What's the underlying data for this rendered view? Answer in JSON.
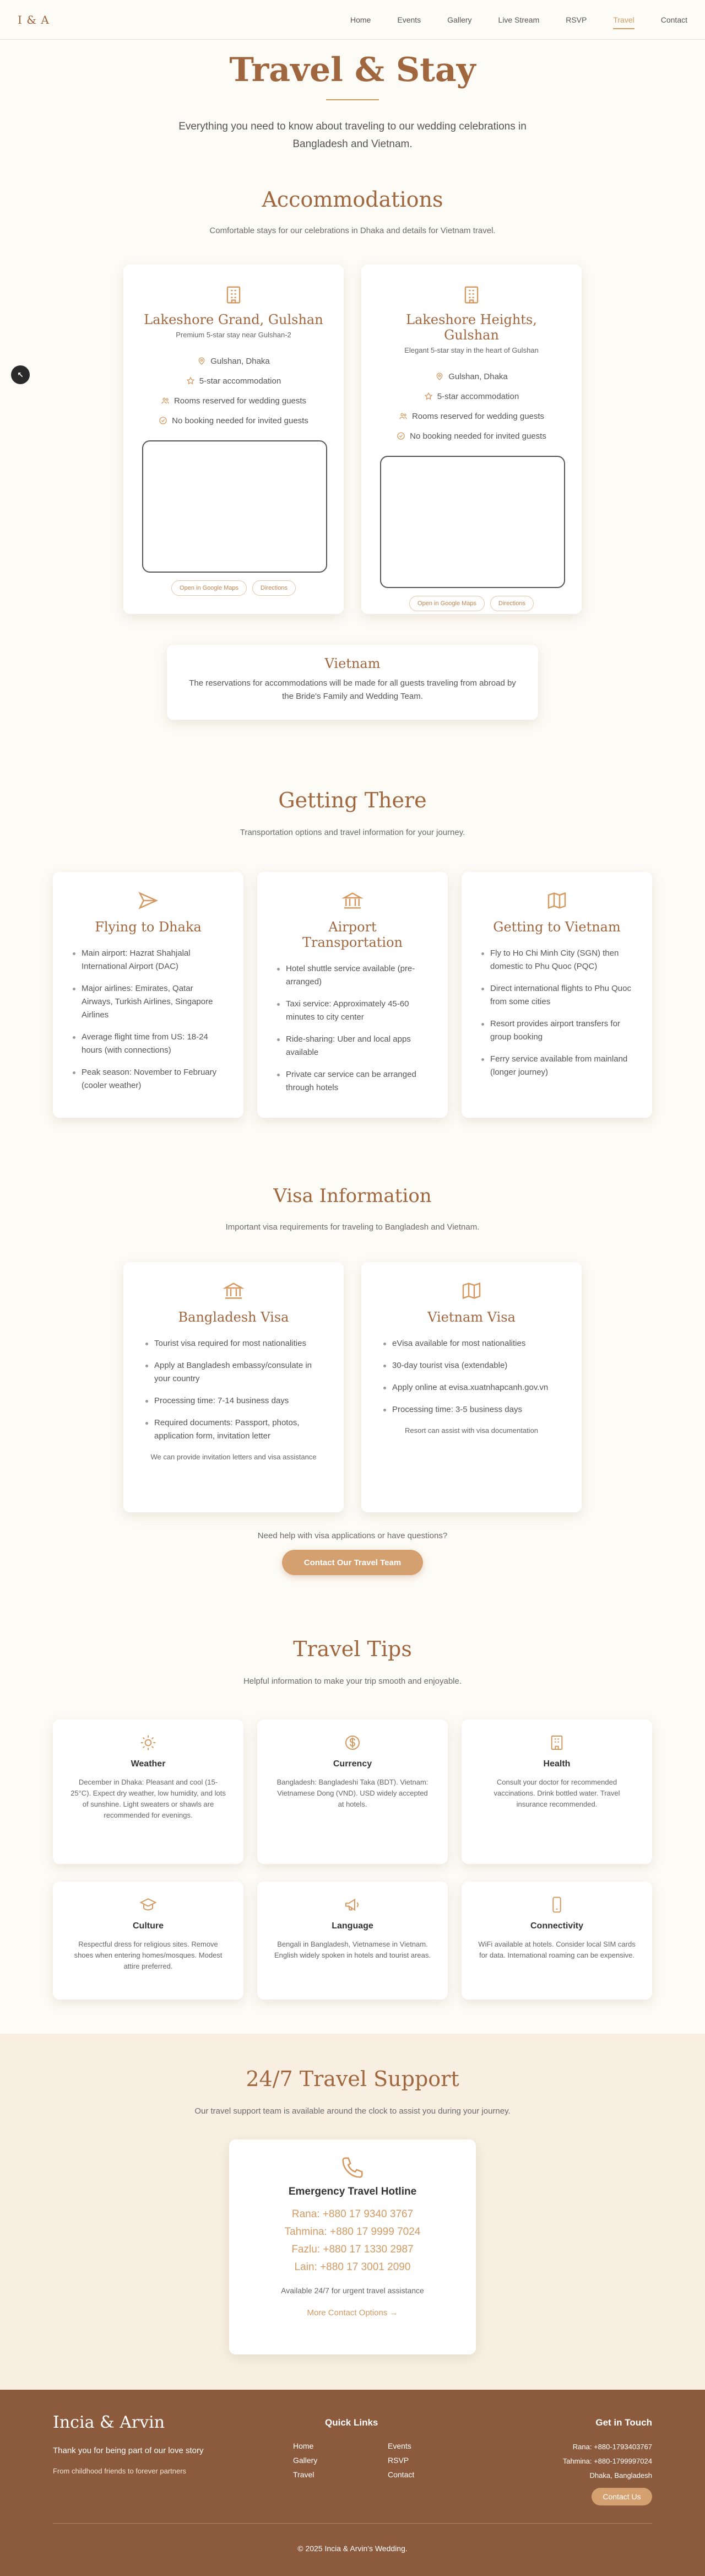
{
  "nav": {
    "logo": "I & A",
    "links": [
      "Home",
      "Events",
      "Gallery",
      "Live Stream",
      "RSVP",
      "Travel",
      "Contact"
    ],
    "active": "Travel"
  },
  "side_button": "↖",
  "hero": {
    "title": "Travel & Stay",
    "text": "Everything you need to know about traveling to our wedding celebrations in Bangladesh and Vietnam."
  },
  "accommodations": {
    "title": "Accommodations",
    "subtitle": "Comfortable stays for our celebrations in Dhaka and details for Vietnam travel.",
    "hotels": [
      {
        "name": "Lakeshore Grand, Gulshan",
        "desc": "Premium 5-star stay near Gulshan-2",
        "location": "Gulshan, Dhaka",
        "rating": "5-star accommodation",
        "rooms": "Rooms reserved for wedding guests",
        "booking": "No booking needed for invited guests",
        "maps_label": "Open in Google Maps",
        "dir_label": "Directions"
      },
      {
        "name": "Lakeshore Heights, Gulshan",
        "desc": "Elegant 5-star stay in the heart of Gulshan",
        "location": "Gulshan, Dhaka",
        "rating": "5-star accommodation",
        "rooms": "Rooms reserved for wedding guests",
        "booking": "No booking needed for invited guests",
        "maps_label": "Open in Google Maps",
        "dir_label": "Directions"
      }
    ],
    "vietnam": {
      "title": "Vietnam",
      "text": "The reservations for accommodations will be made for all guests traveling from abroad by the Bride's Family and Wedding Team."
    }
  },
  "getting_there": {
    "title": "Getting There",
    "subtitle": "Transportation options and travel information for your journey.",
    "cards": [
      {
        "title": "Flying to Dhaka",
        "items": [
          "Main airport: Hazrat Shahjalal International Airport (DAC)",
          "Major airlines: Emirates, Qatar Airways, Turkish Airlines, Singapore Airlines",
          "Average flight time from US: 18-24 hours (with connections)",
          "Peak season: November to February (cooler weather)"
        ]
      },
      {
        "title": "Airport Transportation",
        "items": [
          "Hotel shuttle service available (pre-arranged)",
          "Taxi service: Approximately 45-60 minutes to city center",
          "Ride-sharing: Uber and local apps available",
          "Private car service can be arranged through hotels"
        ]
      },
      {
        "title": "Getting to Vietnam",
        "items": [
          "Fly to Ho Chi Minh City (SGN) then domestic to Phu Quoc (PQC)",
          "Direct international flights to Phu Quoc from some cities",
          "Resort provides airport transfers for group booking",
          "Ferry service available from mainland (longer journey)"
        ]
      }
    ]
  },
  "visa": {
    "title": "Visa Information",
    "subtitle": "Important visa requirements for traveling to Bangladesh and Vietnam.",
    "cards": [
      {
        "title": "Bangladesh Visa",
        "items": [
          "Tourist visa required for most nationalities",
          "Apply at Bangladesh embassy/consulate in your country",
          "Processing time: 7-14 business days",
          "Required documents: Passport, photos, application form, invitation letter"
        ],
        "note": "We can provide invitation letters and visa assistance"
      },
      {
        "title": "Vietnam Visa",
        "items": [
          "eVisa available for most nationalities",
          "30-day tourist visa (extendable)",
          "Apply online at evisa.xuatnhapcanh.gov.vn",
          "Processing time: 3-5 business days"
        ],
        "note": "Resort can assist with visa documentation"
      }
    ],
    "help_text": "Need help with visa applications or have questions?",
    "cta": "Contact Our Travel Team"
  },
  "tips": {
    "title": "Travel Tips",
    "subtitle": "Helpful information to make your trip smooth and enjoyable.",
    "cards": [
      {
        "title": "Weather",
        "text": "December in Dhaka: Pleasant and cool (15-25°C). Expect dry weather, low humidity, and lots of sunshine. Light sweaters or shawls are recommended for evenings."
      },
      {
        "title": "Currency",
        "text": "Bangladesh: Bangladeshi Taka (BDT). Vietnam: Vietnamese Dong (VND). USD widely accepted at hotels."
      },
      {
        "title": "Health",
        "text": "Consult your doctor for recommended vaccinations. Drink bottled water. Travel insurance recommended."
      },
      {
        "title": "Culture",
        "text": "Respectful dress for religious sites. Remove shoes when entering homes/mosques. Modest attire preferred."
      },
      {
        "title": "Language",
        "text": "Bengali in Bangladesh, Vietnamese in Vietnam. English widely spoken in hotels and tourist areas."
      },
      {
        "title": "Connectivity",
        "text": "WiFi available at hotels. Consider local SIM cards for data. International roaming can be expensive."
      }
    ]
  },
  "support": {
    "title": "24/7 Travel Support",
    "subtitle": "Our travel support team is available around the clock to assist you during your journey.",
    "hotline_title": "Emergency Travel Hotline",
    "lines": [
      "Rana: +880 17 9340 3767",
      "Tahmina: +880 17 9999 7024",
      "Fazlu: +880 17 1330 2987",
      "Lain: +880 17 3001 2090"
    ],
    "available": "Available 24/7 for urgent travel assistance",
    "more": "More Contact Options →"
  },
  "footer": {
    "brand": "Incia & Arvin",
    "tagline": "Thank you for being part of our love story",
    "sub": "From childhood friends to forever partners",
    "quick_links_title": "Quick Links",
    "quick_links": [
      "Home",
      "Events",
      "Gallery",
      "RSVP",
      "Travel",
      "Contact"
    ],
    "get_in_touch": "Get in Touch",
    "contacts": [
      "Rana: +880-1793403767",
      "Tahmina: +880-1799997024",
      "Dhaka, Bangladesh"
    ],
    "contact_btn": "Contact Us",
    "copyright": "© 2025 Incia & Arvin's Wedding."
  },
  "colors": {
    "accent": "#a0663e",
    "gold": "#d49a62",
    "background": "#fdfbf6",
    "footer": "#8c5a3c"
  }
}
